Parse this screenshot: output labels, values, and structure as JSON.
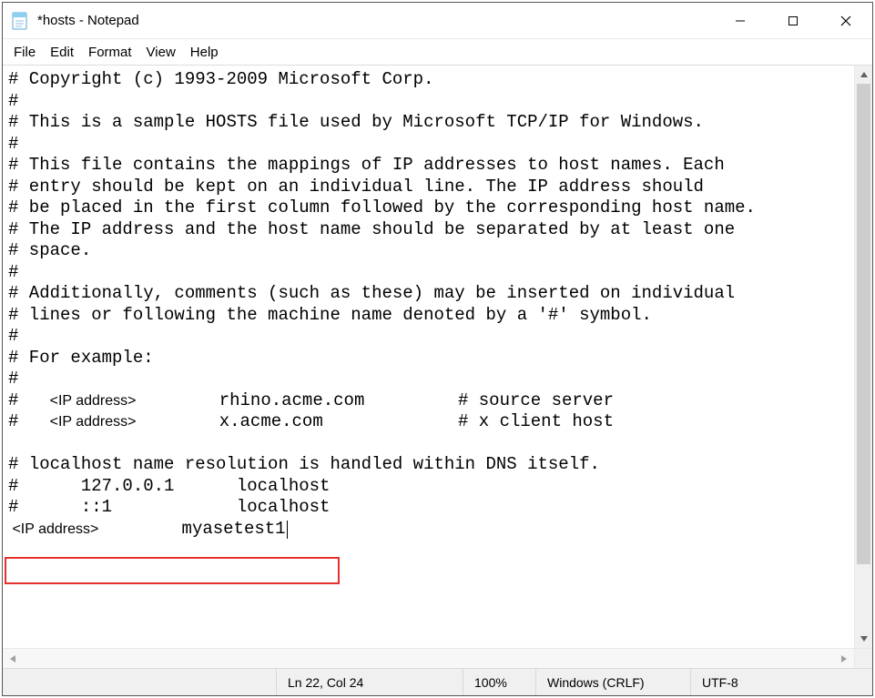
{
  "titlebar": {
    "title": "*hosts - Notepad"
  },
  "menu": {
    "file": "File",
    "edit": "Edit",
    "format": "Format",
    "view": "View",
    "help": "Help"
  },
  "content": {
    "l01": "# Copyright (c) 1993-2009 Microsoft Corp.",
    "l02": "#",
    "l03": "# This is a sample HOSTS file used by Microsoft TCP/IP for Windows.",
    "l04": "#",
    "l05": "# This file contains the mappings of IP addresses to host names. Each",
    "l06": "# entry should be kept on an individual line. The IP address should",
    "l07": "# be placed in the first column followed by the corresponding host name.",
    "l08": "# The IP address and the host name should be separated by at least one",
    "l09": "# space.",
    "l10": "#",
    "l11": "# Additionally, comments (such as these) may be inserted on individual",
    "l12": "# lines or following the machine name denoted by a '#' symbol.",
    "l13": "#",
    "l14": "# For example:",
    "l15": "#",
    "l16_pre": "#   ",
    "l16_ph": "<IP address>",
    "l16_post": "        rhino.acme.com         # source server",
    "l17_pre": "#   ",
    "l17_ph": "<IP address>",
    "l17_post": "        x.acme.com             # x client host",
    "l18": "",
    "l19": "# localhost name resolution is handled within DNS itself.",
    "l20": "#      127.0.0.1      localhost",
    "l21": "#      ::1            localhost",
    "l22_ph": " <IP address>",
    "l22_post": "        myasetest1"
  },
  "statusbar": {
    "position": "Ln 22, Col 24",
    "zoom": "100%",
    "eol": "Windows (CRLF)",
    "encoding": "UTF-8"
  }
}
